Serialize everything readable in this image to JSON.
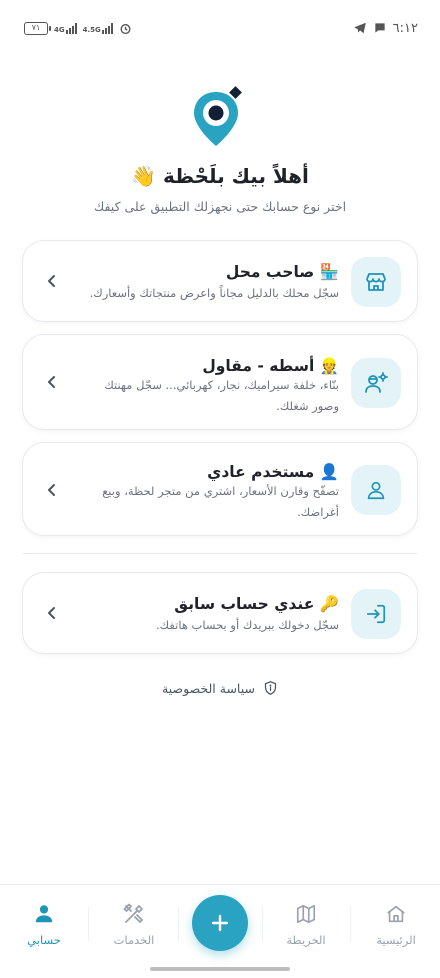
{
  "status_bar": {
    "time": "٦:١٢",
    "battery": "٧١",
    "network_1": "4G",
    "network_2": "4.5G"
  },
  "header": {
    "welcome": "أهلاً بيك بلَحْظة",
    "welcome_emoji": "👋",
    "subtitle": "اختر نوع حسابك حتى نجهزلك التطبيق على كيفك"
  },
  "account_types": [
    {
      "emoji": "🏪",
      "title": "صاحب محل",
      "description": "سجّل محلك بالدليل مجاناً واعرض منتجاتك وأسعارك.",
      "icon": "store-icon"
    },
    {
      "emoji": "👷",
      "title": "أسطه - مقاول",
      "description": "بنّاء، خلفة سيراميك، نجار، كهربائي... سجّل مهنتك وصور شغلك.",
      "icon": "worker-gear-icon"
    },
    {
      "emoji": "👤",
      "title": "مستخدم عادي",
      "description": "تصفّح وقارن الأسعار، اشتري من متجر لحظة، وبيع أغراضك.",
      "icon": "user-icon"
    }
  ],
  "existing_account": {
    "emoji": "🔑",
    "title": "عندي حساب سابق",
    "description": "سجّل دخولك ببريدك أو بحساب هاتفك.",
    "icon": "login-icon"
  },
  "privacy": {
    "label": "سياسة الخصوصية"
  },
  "bottom_nav": {
    "items": [
      {
        "label": "الرئيسية",
        "icon": "home-icon",
        "active": false
      },
      {
        "label": "الخريطة",
        "icon": "map-icon",
        "active": false
      },
      {
        "label": "الخدمات",
        "icon": "tools-icon",
        "active": false
      },
      {
        "label": "حسابي",
        "icon": "person-icon",
        "active": true
      }
    ],
    "fab_icon": "plus-icon"
  },
  "colors": {
    "accent": "#2aa3c2",
    "icon_bg": "#e3f3f7",
    "active_nav": "#1f95b6"
  }
}
